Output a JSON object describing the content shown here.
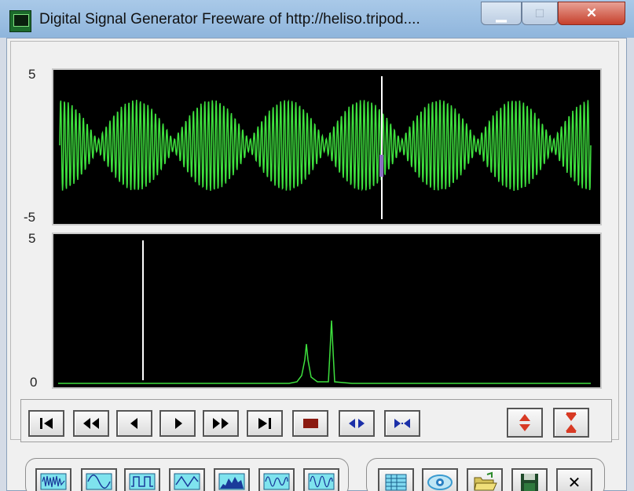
{
  "window": {
    "title": "Digital Signal Generator  Freeware of http://heliso.tripod....",
    "minimize_glyph": "▁",
    "maximize_glyph": "□",
    "close_glyph": "✕"
  },
  "time_plot": {
    "y_max_label": "5",
    "y_min_label": "-5"
  },
  "spectrum_plot": {
    "y_max_label": "5",
    "y_min_label": "0"
  },
  "colors": {
    "trace": "#3ee03e",
    "marker": "#ffffff",
    "plot_bg": "#000000",
    "stop": "#8b1a10",
    "arrow_blue": "#1b2fa8",
    "arrow_red": "#d83a24"
  },
  "toolbar": {
    "playback_icons": [
      "skip-to-start-icon",
      "rewind-icon",
      "step-back-icon",
      "play-icon",
      "fast-forward-icon",
      "skip-to-end-icon",
      "stop-icon",
      "expand-horizontal-icon",
      "compress-horizontal-icon"
    ],
    "scale_icons": [
      "expand-vertical-icon",
      "compress-vertical-icon"
    ]
  },
  "waveform_buttons": [
    "noise-wave-icon",
    "sine-wave-icon",
    "square-wave-icon",
    "triangle-wave-icon",
    "spectrum-area-icon",
    "modulated-wave-icon",
    "burst-wave-icon"
  ],
  "file_buttons": [
    "table-icon",
    "eye-icon",
    "open-folder-icon",
    "save-disk-icon"
  ],
  "exit_button": {
    "label": "✕"
  }
}
